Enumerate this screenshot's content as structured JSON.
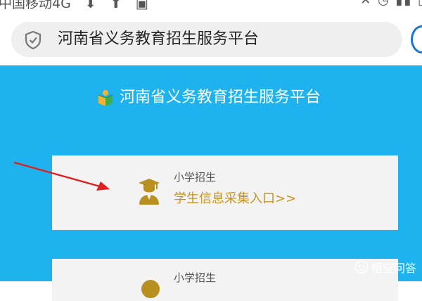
{
  "status_bar": {
    "carrier": "中国移动4G",
    "icons": [
      "download-icon",
      "upload-icon",
      "image-icon",
      "mute-icon",
      "alarm-icon",
      "signal-icon",
      "battery-icon"
    ]
  },
  "address_bar": {
    "url_text": "河南省义务教育招生服务平台",
    "icon": "shield-icon"
  },
  "site": {
    "title": "河南省义务教育招生服务平台",
    "logo_icon": "book-logo-icon"
  },
  "cards": [
    {
      "label": "小学招生",
      "link": "学生信息采集入口>>",
      "icon": "graduate-icon"
    },
    {
      "label": "小学招生",
      "icon": "graduate-icon"
    }
  ],
  "watermark": {
    "text": "悟空问答",
    "icon": "wukong-logo-icon"
  },
  "colors": {
    "main_background": "#1eb3ee",
    "card_background": "#f3f3f3",
    "link_gold": "#c8941c",
    "annotation_red": "#e02020"
  }
}
